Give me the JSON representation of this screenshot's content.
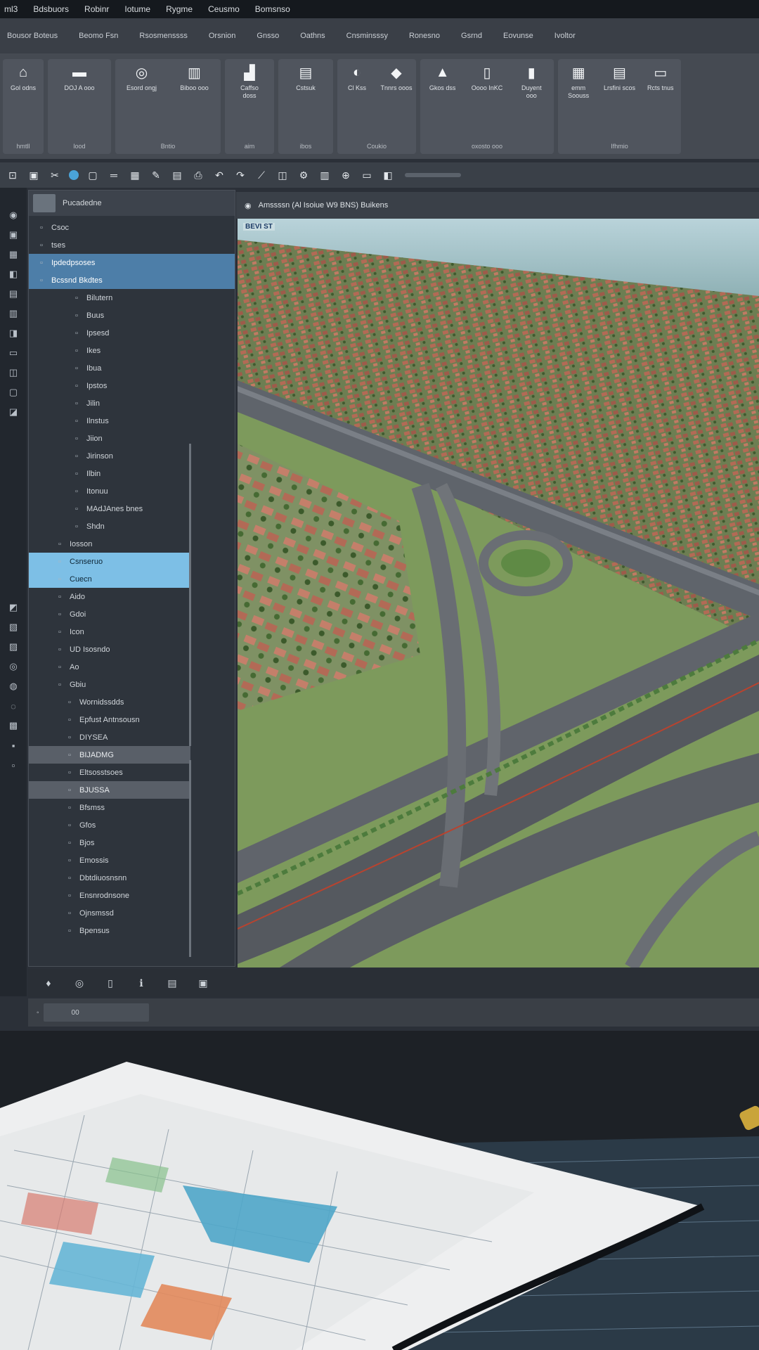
{
  "menubar": [
    "ml3",
    "Bdsbuors",
    "Robinr",
    "Iotume",
    "Rygme",
    "Ceusmo",
    "Bomsnso"
  ],
  "ribbon": {
    "tabs": [
      "Bousor Boteus",
      "Beomo Fsn",
      "Rsosmenssss",
      "Orsnion",
      "Gnsso",
      "Oathns",
      "Cnsminsssy",
      "Ronesno",
      "Gsrnd",
      "Eovunse",
      "Ivoltor"
    ],
    "groups": [
      {
        "name": "hmtll",
        "buttons": [
          {
            "icon": "home-icon",
            "glyph": "⌂",
            "label": "Gol odns"
          }
        ]
      },
      {
        "name": "lood",
        "buttons": [
          {
            "icon": "rectangle-icon",
            "glyph": "▬",
            "label": "DOJ A ooo"
          }
        ]
      },
      {
        "name": "Bntio",
        "buttons": [
          {
            "icon": "target-icon",
            "glyph": "◎",
            "label": "Esord ongj"
          },
          {
            "icon": "building-icon",
            "glyph": "▥",
            "label": "Biboo ooo"
          }
        ]
      },
      {
        "name": "aim",
        "buttons": [
          {
            "icon": "chart-icon",
            "glyph": "▟",
            "label": "Caffso doss"
          }
        ]
      },
      {
        "name": "ibos",
        "buttons": [
          {
            "icon": "document-icon",
            "glyph": "▤",
            "label": "Cstsuk"
          }
        ]
      },
      {
        "name": "Coukio",
        "buttons": [
          {
            "icon": "compass-icon",
            "glyph": "◐",
            "label": "Cl Kss"
          },
          {
            "icon": "layer-icon",
            "glyph": "◆",
            "label": "Tnnrs ooos"
          }
        ]
      },
      {
        "name": "oxosto ooo",
        "buttons": [
          {
            "icon": "triangle-icon",
            "glyph": "▲",
            "label": "Gkos dss"
          },
          {
            "icon": "file-icon",
            "glyph": "▯",
            "label": "Oooo InKC"
          },
          {
            "icon": "clipboard-icon",
            "glyph": "▮",
            "label": "Duyent ooo"
          }
        ]
      },
      {
        "name": "Ifhmio",
        "buttons": [
          {
            "icon": "grid-icon",
            "glyph": "▦",
            "label": "emm Soouss"
          },
          {
            "icon": "tables-icon",
            "glyph": "▤",
            "label": "Lrsfini scos"
          },
          {
            "icon": "monitor-icon",
            "glyph": "▭",
            "label": "Rcts tnus"
          }
        ]
      }
    ]
  },
  "panel": {
    "title": "Pucadedne",
    "tree": [
      {
        "label": "Csoc",
        "style": "normal"
      },
      {
        "label": "tses",
        "style": "normal"
      },
      {
        "label": "Ipdedpsoses",
        "style": "hl"
      },
      {
        "label": "Bcssnd Bkdtes",
        "style": "hl"
      },
      {
        "label": "Bilutern",
        "style": "normal"
      },
      {
        "label": "Buus",
        "style": "normal"
      },
      {
        "label": "Ipsesd",
        "style": "normal"
      },
      {
        "label": "Ikes",
        "style": "normal"
      },
      {
        "label": "Ibua",
        "style": "normal"
      },
      {
        "label": "Ipstos",
        "style": "normal"
      },
      {
        "label": "Jilin",
        "style": "normal"
      },
      {
        "label": "Ilnstus",
        "style": "normal"
      },
      {
        "label": "Jiion",
        "style": "normal"
      },
      {
        "label": "Jirinson",
        "style": "normal"
      },
      {
        "label": "Ilbin",
        "style": "normal"
      },
      {
        "label": "Itonuu",
        "style": "normal"
      },
      {
        "label": "MAdJAnes bnes",
        "style": "normal"
      },
      {
        "label": "Shdn",
        "style": "normal"
      },
      {
        "label": "Iosson",
        "style": "normal"
      },
      {
        "label": "Csnseruo",
        "style": "hl2"
      },
      {
        "label": "Cuecn",
        "style": "hl2"
      },
      {
        "label": "Aido",
        "style": "normal"
      },
      {
        "label": "Gdoi",
        "style": "normal"
      },
      {
        "label": "Icon",
        "style": "normal"
      },
      {
        "label": "UD Isosndo",
        "style": "normal"
      },
      {
        "label": "Ao",
        "style": "normal"
      },
      {
        "label": "Gbiu",
        "style": "normal"
      },
      {
        "label": "Wornidssdds",
        "style": "normal"
      },
      {
        "label": "Epfust Antnsousn",
        "style": "normal"
      },
      {
        "label": "DIYSEA",
        "style": "normal"
      },
      {
        "label": "BIJADMG",
        "style": "grey"
      },
      {
        "label": "Eltsosstsoes",
        "style": "normal"
      },
      {
        "label": "BJUSSA",
        "style": "grey"
      },
      {
        "label": "Bfsmss",
        "style": "normal"
      },
      {
        "label": "Gfos",
        "style": "normal"
      },
      {
        "label": "Bjos",
        "style": "normal"
      },
      {
        "label": "Emossis",
        "style": "normal"
      },
      {
        "label": "Dbtdiuosnsnn",
        "style": "normal"
      },
      {
        "label": "Ensnrodnsone",
        "style": "normal"
      },
      {
        "label": "Ojnsmssd",
        "style": "normal"
      },
      {
        "label": "Bpensus",
        "style": "normal"
      }
    ]
  },
  "viewport": {
    "tab_label": "Amssssn (Al Isoiue W9 BNS) Buikens",
    "corner_label": "BEVI ST"
  },
  "statusbar": {
    "field": "00"
  },
  "colors": {
    "accent": "#4d7ea8",
    "highlight": "#7dbfe6",
    "sky": "#a9c9d4",
    "roofs": "#a8614f",
    "road": "#5b5f66"
  }
}
